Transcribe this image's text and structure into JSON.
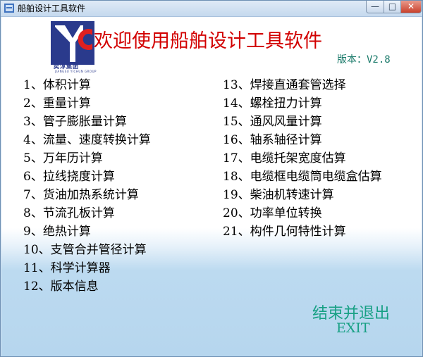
{
  "window": {
    "title": "船舶设计工具软件",
    "minimize_glyph": "—",
    "maximize_glyph": "□",
    "close_glyph": "✕"
  },
  "logo": {
    "letters": "YC",
    "caption": "奕淳集团",
    "subcaption": "JIANGSU YICHUN GROUP"
  },
  "header": {
    "welcome": "欢迎使用船舶设计工具软件",
    "version": "版本：V2.8"
  },
  "menu": {
    "left": [
      "1、体积计算",
      "2、重量计算",
      "3、管子膨胀量计算",
      "4、流量、速度转换计算",
      "5、万年历计算",
      "6、拉线挠度计算",
      "7、货油加热系统计算",
      "8、节流孔板计算",
      "9、绝热计算",
      "10、支管合并管径计算",
      "11、科学计算器",
      "12、版本信息"
    ],
    "right": [
      "13、焊接直通套管选择",
      "14、螺栓扭力计算",
      "15、通风风量计算",
      "16、轴系轴径计算",
      "17、电缆托架宽度估算",
      "18、电缆框电缆筒电缆盒估算",
      "19、柴油机转速计算",
      "20、功率单位转换",
      "21、构件几何特性计算"
    ]
  },
  "exit": {
    "label_cn": "结束并退出",
    "label_en": "EXIT"
  },
  "colors": {
    "title_red": "#d20000",
    "accent_teal": "#17a084",
    "version_teal": "#1a7a6a",
    "logo_blue": "#2a3a8c",
    "logo_red": "#e02020"
  }
}
